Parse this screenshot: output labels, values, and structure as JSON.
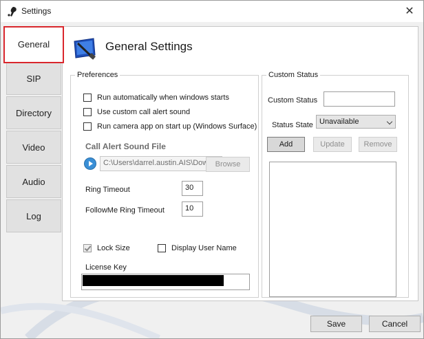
{
  "window": {
    "title": "Settings",
    "close_glyph": "✕"
  },
  "tabs": [
    {
      "label": "General",
      "active": true
    },
    {
      "label": "SIP",
      "active": false
    },
    {
      "label": "Directory",
      "active": false
    },
    {
      "label": "Video",
      "active": false
    },
    {
      "label": "Audio",
      "active": false
    },
    {
      "label": "Log",
      "active": false
    }
  ],
  "header": {
    "title": "General Settings",
    "icon": "settings-screen-icon"
  },
  "preferences": {
    "legend": "Preferences",
    "checkboxes": [
      {
        "label": "Run automatically when windows starts",
        "checked": false
      },
      {
        "label": "Use custom call alert sound",
        "checked": false
      },
      {
        "label": "Run camera app on start up (Windows Surface)",
        "checked": false
      }
    ],
    "call_alert": {
      "heading": "Call Alert Sound File",
      "path_value": "C:\\Users\\darrel.austin.AIS\\Dow",
      "browse_label": "Browse"
    },
    "ring_timeout": {
      "label": "Ring Timeout",
      "value": "30"
    },
    "followme_timeout": {
      "label": "FollowMe Ring Timeout",
      "value": "10"
    },
    "lock_size": {
      "label": "Lock Size",
      "checked": true
    },
    "display_user_name": {
      "label": "Display User Name",
      "checked": false
    },
    "license_key": {
      "label": "License Key",
      "value": ""
    }
  },
  "custom_status": {
    "legend": "Custom Status",
    "status_label": "Custom Status",
    "status_value": "",
    "state_label": "Status State",
    "state_value": "Unavailable",
    "add_label": "Add",
    "update_label": "Update",
    "remove_label": "Remove"
  },
  "footer": {
    "save_label": "Save",
    "cancel_label": "Cancel"
  },
  "colors": {
    "active_tab_border": "#d9262c",
    "accent": "#3a8fd6"
  }
}
